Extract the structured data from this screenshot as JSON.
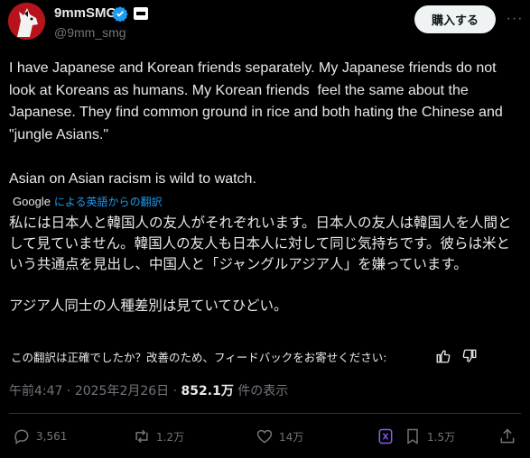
{
  "author": {
    "display_name": "9mmSMG",
    "handle": "@9mm_smg",
    "verified_icon": "verified-badge-icon",
    "subscribe_label": "購入する"
  },
  "tweet": {
    "text": "I have Japanese and Korean friends separately. My Japanese friends do not look at Koreans as humans. My Korean friends  feel the same about the Japanese. They find common ground in rice and both hating the Chinese and \"jungle Asians.\"\n\nAsian on Asian racism is wild to watch.",
    "google_label": "Google",
    "translated_by": "による英語からの翻訳",
    "translation": "私には日本人と韓国人の友人がそれぞれいます。日本人の友人は韓国人を人間として見ていません。韓国人の友人も日本人に対して同じ気持ちです。彼らは米という共通点を見出し、中国人と「ジャングルアジア人」を嫌っています。\n\nアジア人同士の人種差別は見ていてひどい。",
    "feedback_prompt": "この翻訳は正確でしたか？改善のため、フィードバックをお寄せください:"
  },
  "meta": {
    "time": "午前4:47",
    "separator": "·",
    "date": "2025年2月26日",
    "views_count": "852.1万",
    "views_label": "件の表示"
  },
  "actions": {
    "replies": "3,561",
    "reposts": "1.2万",
    "likes": "14万",
    "bookmarks": "1.5万"
  },
  "colors": {
    "accent": "#1d9bf0",
    "avatar": "#b7131d",
    "grok": "#8b5cf6"
  }
}
